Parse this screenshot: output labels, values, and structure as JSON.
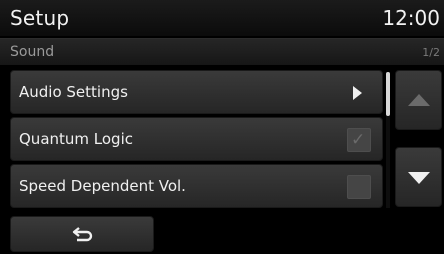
{
  "header": {
    "title": "Setup",
    "clock": "12:00"
  },
  "subheader": {
    "title": "Sound",
    "page_indicator": "1/2"
  },
  "menu": {
    "items": [
      {
        "label": "Audio Settings",
        "control": "arrow-right-icon"
      },
      {
        "label": "Quantum Logic",
        "control": "checkbox",
        "checked": true
      },
      {
        "label": "Speed Dependent Vol.",
        "control": "checkbox",
        "checked": false
      }
    ]
  },
  "scroll": {
    "up_icon": "triangle-up-icon",
    "down_icon": "triangle-down-icon",
    "up_enabled": false,
    "down_enabled": true
  },
  "footer": {
    "back_icon": "back-arrow-icon"
  },
  "colors": {
    "background": "#000000",
    "item": "#303030",
    "text": "#f0f0f0",
    "muted": "#9a9a9a"
  }
}
